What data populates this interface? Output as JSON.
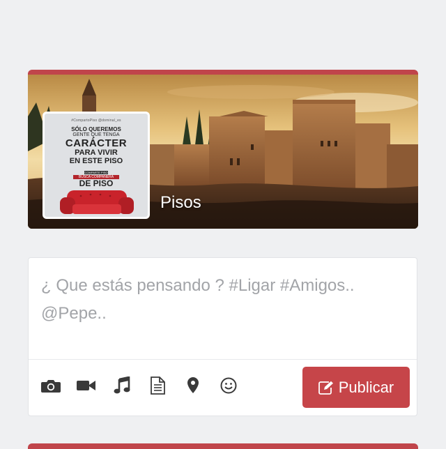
{
  "cover": {
    "title": "Pisos",
    "accent_color": "#c0454b",
    "background": "alhambra-landscape-photo",
    "profile_image": {
      "tags_line": "#CompartoPiso  @dominal_es",
      "line1": "SÓLO QUEREMOS",
      "line2": "GENTE QUE TENGA",
      "line3": "CARÁCTER",
      "line4": "PARA VIVIR",
      "line5": "EN ESTE PISO",
      "badge_top": "COMPARTE PISO",
      "badge_mid": "BUSCA COMPAÑERA",
      "badge_main": "DE PISO"
    }
  },
  "composer": {
    "placeholder": "¿ Que estás pensando ? #Ligar #Amigos.. @Pepe..",
    "value": "",
    "tools": [
      {
        "icon": "camera-icon"
      },
      {
        "icon": "video-icon"
      },
      {
        "icon": "music-icon"
      },
      {
        "icon": "document-icon"
      },
      {
        "icon": "location-pin-icon"
      },
      {
        "icon": "smiley-icon"
      }
    ],
    "publish_label": "Publicar",
    "publish_icon": "edit-icon",
    "publish_color": "#c64549"
  }
}
